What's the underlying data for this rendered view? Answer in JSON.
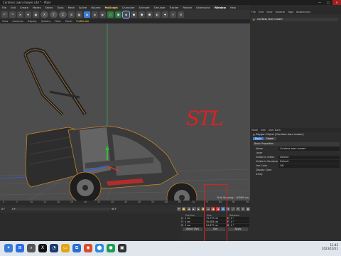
{
  "window": {
    "title": "Cordless lawn mower.c4d * - Main",
    "minimize": "—",
    "maximize": "□",
    "close": "✕"
  },
  "menu": {
    "items": [
      {
        "label": "File",
        "state": "normal"
      },
      {
        "label": "Edit",
        "state": "normal"
      },
      {
        "label": "Create",
        "state": "normal"
      },
      {
        "label": "Modes",
        "state": "normal"
      },
      {
        "label": "Select",
        "state": "normal"
      },
      {
        "label": "Tools",
        "state": "normal"
      },
      {
        "label": "Mesh",
        "state": "normal"
      },
      {
        "label": "Spline",
        "state": "normal"
      },
      {
        "label": "Volume",
        "state": "normal"
      },
      {
        "label": "MoGraph",
        "state": "highlight"
      },
      {
        "label": "Character",
        "state": "normal"
      },
      {
        "label": "Animate",
        "state": "normal"
      },
      {
        "label": "Simulate",
        "state": "normal"
      },
      {
        "label": "Tracker",
        "state": "normal"
      },
      {
        "label": "Render",
        "state": "normal"
      },
      {
        "label": "Extensions",
        "state": "normal"
      },
      {
        "label": "Window",
        "state": "selected"
      },
      {
        "label": "Help",
        "state": "normal"
      }
    ]
  },
  "toolbar": {
    "buttons": [
      {
        "label": "↶",
        "kind": "normal"
      },
      {
        "label": "↷",
        "kind": "normal"
      },
      {
        "label": "➤",
        "kind": "normal"
      },
      {
        "label": "✥",
        "kind": "normal"
      },
      {
        "label": "▣",
        "kind": "normal"
      },
      {
        "label": "X",
        "kind": "pill"
      },
      {
        "label": "Y",
        "kind": "pill"
      },
      {
        "label": "Z",
        "kind": "pill"
      },
      {
        "label": "⊕",
        "kind": "normal"
      },
      {
        "label": "▦",
        "kind": "normal"
      },
      {
        "label": "◉",
        "kind": "active"
      },
      {
        "label": "◈",
        "kind": "normal"
      },
      {
        "label": "▶",
        "kind": "normal"
      },
      {
        "label": "⬡",
        "kind": "green"
      },
      {
        "label": "⬢",
        "kind": "green"
      },
      {
        "label": "◆",
        "kind": "sel"
      },
      {
        "label": "⬟",
        "kind": "normal"
      },
      {
        "label": "⬢",
        "kind": "normal"
      },
      {
        "label": "⬣",
        "kind": "normal"
      },
      {
        "label": "◐",
        "kind": "normal"
      },
      {
        "label": "✚",
        "kind": "normal"
      },
      {
        "label": "☀",
        "kind": "normal"
      },
      {
        "label": "⚙",
        "kind": "normal"
      }
    ]
  },
  "viewport_menu": {
    "items": [
      "View",
      "Cameras",
      "Display",
      "Options",
      "Filter",
      "Panel",
      "ProRender"
    ],
    "highlight_index": 6
  },
  "viewport": {
    "grid_spacing": "Grid Spacing : 10000 cm"
  },
  "timeline": {
    "ticks": [
      "0",
      "5",
      "10",
      "15",
      "20",
      "25",
      "30",
      "35",
      "40",
      "45",
      "50",
      "55",
      "60",
      "65",
      "70",
      "75",
      "80",
      "85",
      "90"
    ],
    "frame_start": "0 F",
    "frame_end": "90 F",
    "current_frame": "0 F"
  },
  "coordinates": {
    "headers": [
      "Position",
      "Size",
      "Rotation"
    ],
    "rows": [
      {
        "axis": "X",
        "position": "0 cm",
        "size": "73.777 cm",
        "rotation": "H",
        "rotation_value": "0 °"
      },
      {
        "axis": "Y",
        "position": "0 cm",
        "size": "55.583 cm",
        "rotation": "P",
        "rotation_value": "0 °"
      },
      {
        "axis": "Z",
        "position": "0 cm",
        "size": "54.877 cm",
        "rotation": "B",
        "rotation_value": "0 °"
      }
    ],
    "mode_select": "Object (Rel)",
    "size_select": "Size",
    "apply": "Apply"
  },
  "object_manager": {
    "tabs": [
      "File",
      "Edit",
      "View",
      "Objects",
      "Tags",
      "Bookmarks"
    ],
    "object_name": "Cordless lawn mower"
  },
  "attribute_manager": {
    "tabs": [
      "Mode",
      "Edit",
      "User Data"
    ],
    "object_title": "Polygon Object [Cordless lawn mower]",
    "sub_tabs": [
      "Basic",
      "Coord."
    ],
    "section": "Basic Properties",
    "fields": [
      {
        "label": "Name",
        "value": "Cordless lawn mower"
      },
      {
        "label": "Layer",
        "value": ""
      },
      {
        "label": "Visible in Editor",
        "value": "Default"
      },
      {
        "label": "Visible in Renderer",
        "value": "Default"
      },
      {
        "label": "Use Color",
        "value": "Off"
      },
      {
        "label": "Display Color",
        "value": ""
      },
      {
        "label": "X-Ray",
        "value": ""
      }
    ]
  },
  "annotation": {
    "text": "STL"
  },
  "taskbar": {
    "apps": [
      {
        "label": "✦",
        "color": "#3a7bd5"
      },
      {
        "label": "⊞",
        "color": "#2d6be0"
      },
      {
        "label": "⌕",
        "color": "#555555"
      },
      {
        "label": "X",
        "color": "#111111"
      },
      {
        "label": "◔",
        "color": "#1c3a6e"
      },
      {
        "label": "▭",
        "color": "#e2a617"
      },
      {
        "label": "⧉",
        "color": "#2b6fd1"
      },
      {
        "label": "◉",
        "color": "#dd4a2f"
      },
      {
        "label": "⬤",
        "color": "#2f8ad9"
      },
      {
        "label": "●",
        "color": "#1f9d55"
      },
      {
        "label": "▣",
        "color": "#333333"
      }
    ],
    "time": "11:42",
    "date": "2023/10/11"
  }
}
